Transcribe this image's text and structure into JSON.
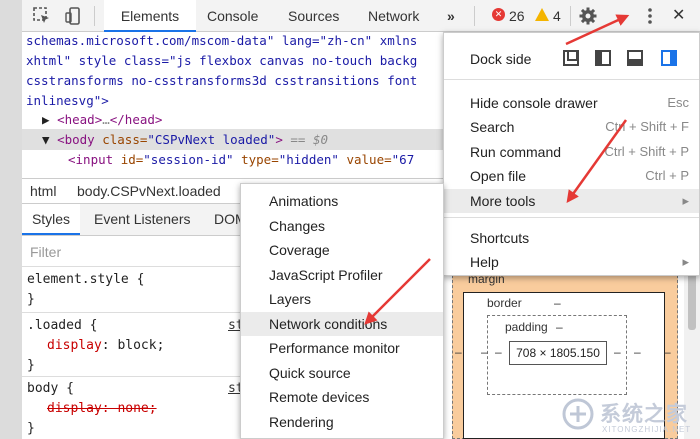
{
  "toolbar": {
    "tabs": [
      "Elements",
      "Console",
      "Sources",
      "Network"
    ],
    "more_tabs": "»",
    "errors": "26",
    "warnings": "4",
    "close": "✕"
  },
  "code": {
    "line1": "schemas.microsoft.com/mscom-data\" lang=\"zh-cn\" xmlns",
    "line2": "xhtml\" style class=\"js flexbox canvas no-touch backg",
    "line3": "csstransforms no-csstransforms3d csstransitions font",
    "line4": "inlinesvg\">",
    "line5_tag": "<head>",
    "line5_dots": "…",
    "line5_close": "</head>",
    "line6_open": "<body ",
    "line6_attr": "class=",
    "line6_val": "\"CSPvNext loaded\"",
    "line6_close": ">",
    "line6_eq": " == $0",
    "line7_tag": "<input ",
    "line7_id": "id=",
    "line7_idv": "\"session-id\"",
    "line7_type": " type=",
    "line7_typev": "\"hidden\"",
    "line7_value": " value=",
    "line7_valuev": "\"67"
  },
  "breadcrumb": [
    "html",
    "body.CSPvNext.loaded"
  ],
  "styles_tabs": [
    "Styles",
    "Event Listeners",
    "DOM"
  ],
  "filter_placeholder": "Filter",
  "rules": {
    "r1_selector": "element.style {",
    "r1_close": "}",
    "r2_selector": ".loaded {",
    "r2_prop": "display",
    "r2_val": ": block;",
    "r2_close": "}",
    "r2_src": "st",
    "r3_selector": "body {",
    "r3_prop": "display: none;",
    "r3_close": "}",
    "r3_src": "st"
  },
  "box_model": {
    "margin": "margin",
    "border": "border",
    "padding": "padding",
    "dash": "–",
    "content": "708 × 1805.150"
  },
  "main_menu": {
    "dock_side": "Dock side",
    "items": [
      {
        "label": "Hide console drawer",
        "key": "Esc"
      },
      {
        "label": "Search",
        "key": "Ctrl + Shift + F"
      },
      {
        "label": "Run command",
        "key": "Ctrl + Shift + P"
      },
      {
        "label": "Open file",
        "key": "Ctrl + P"
      },
      {
        "label": "More tools",
        "key": "▸"
      }
    ],
    "items2": [
      {
        "label": "Shortcuts",
        "key": ""
      },
      {
        "label": "Help",
        "key": "▸"
      }
    ]
  },
  "submenu": {
    "items": [
      "Animations",
      "Changes",
      "Coverage",
      "JavaScript Profiler",
      "Layers",
      "Network conditions",
      "Performance monitor",
      "Quick source",
      "Remote devices",
      "Rendering"
    ]
  },
  "watermark": {
    "text": "系统之家",
    "sub": "XITONGZHIJIA.NET"
  },
  "colors": {
    "accent": "#1a73e8",
    "arrow": "#e53935",
    "error": "#e53935",
    "warning": "#f4b400",
    "margin_box": "#f9cc9d"
  }
}
